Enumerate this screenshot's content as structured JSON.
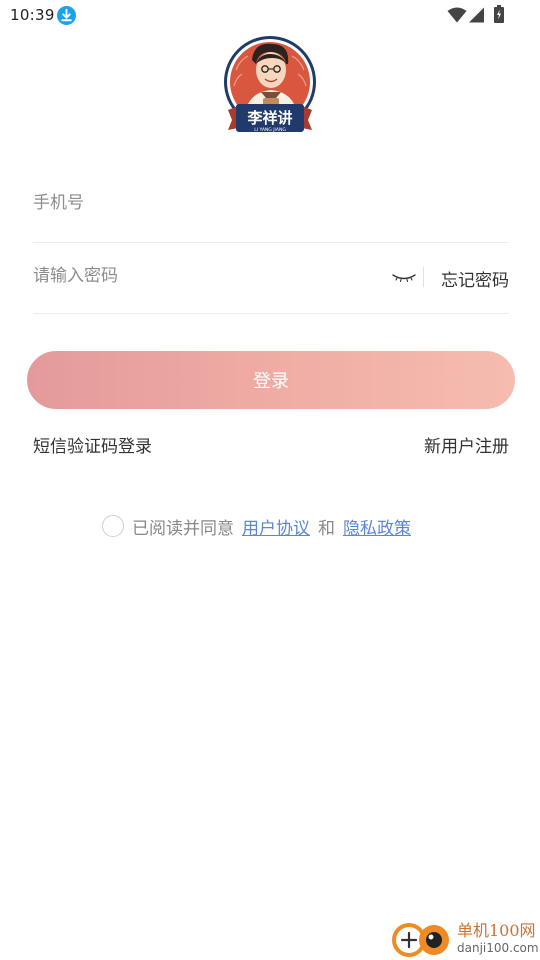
{
  "status_bar": {
    "time": "10:39",
    "icons": [
      "download-icon",
      "wifi-icon",
      "signal-icon",
      "battery-icon"
    ]
  },
  "logo": {
    "brand_text": "李祥讲",
    "brand_subtext": "LI YANG JIANG"
  },
  "form": {
    "phone_placeholder": "手机号",
    "password_placeholder": "请输入密码",
    "forgot_password": "忘记密码",
    "login_button": "登录",
    "sms_login": "短信验证码登录",
    "register": "新用户注册"
  },
  "agreement": {
    "checked": false,
    "prefix": "已阅读并同意",
    "user_agreement": "用户协议",
    "and": "和",
    "privacy_policy": "隐私政策"
  },
  "watermark": {
    "title": "单机100网",
    "url": "danji100.com"
  },
  "colors": {
    "button_start": "#e49a9c",
    "button_end": "#f6bcaf",
    "link": "#5b86d8",
    "logo_red": "#d9563f",
    "logo_navy": "#1f3a6b"
  }
}
